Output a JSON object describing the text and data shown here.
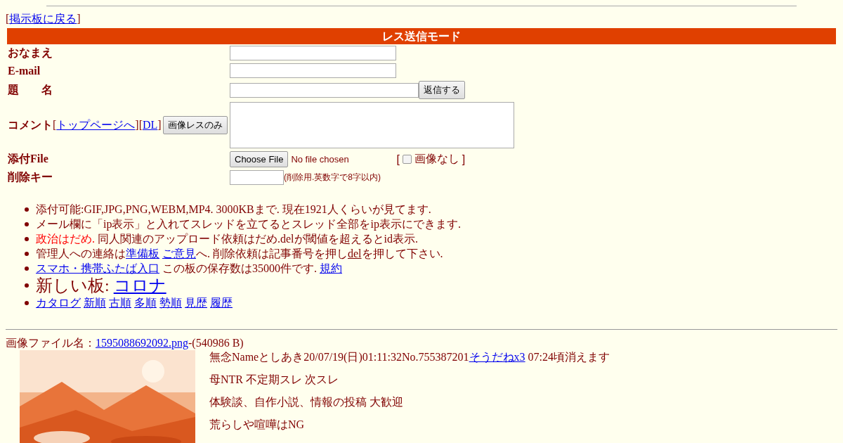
{
  "back_nav": [
    {
      "kind": "plain",
      "text": "["
    },
    {
      "kind": "link",
      "text": "掲示板に戻る"
    },
    {
      "kind": "plain",
      "text": "]"
    }
  ],
  "form": {
    "title": "レス送信モード",
    "rows": [
      {
        "kind": "text",
        "label": "おなまえ"
      },
      {
        "kind": "text",
        "label": "E-mail"
      },
      {
        "kind": "subject",
        "label": "題　　名",
        "button": "返信する"
      },
      {
        "kind": "comment",
        "label": "コメント",
        "extra": [
          {
            "kind": "plain",
            "text": "["
          },
          {
            "kind": "link",
            "text": "トップページへ"
          },
          {
            "kind": "plain",
            "text": "]["
          },
          {
            "kind": "link",
            "text": "DL"
          },
          {
            "kind": "plain",
            "text": "]"
          }
        ],
        "button": "画像レスのみ"
      },
      {
        "kind": "file",
        "label": "添付File",
        "button": "Choose File",
        "status": "No file chosen",
        "bracket_open": "[",
        "option": "画像なし",
        "bracket_close": "]",
        "checked": false
      },
      {
        "kind": "key",
        "label": "削除キー",
        "note": "(削除用.英数字で8字以内)"
      }
    ]
  },
  "notices": [
    {
      "large": false,
      "parts": [
        {
          "kind": "plain",
          "text": "添付可能:GIF,JPG,PNG,WEBM,MP4. 3000KBまで. 現在1921人くらいが見てます."
        }
      ]
    },
    {
      "large": false,
      "parts": [
        {
          "kind": "plain",
          "text": "メール欄に「ip表示」と入れてスレッドを立てるとスレッド全部をip表示にできます."
        }
      ]
    },
    {
      "large": false,
      "parts": [
        {
          "kind": "alert",
          "text": "政治はだめ."
        },
        {
          "kind": "plain",
          "text": " 同人関連のアップロード依頼はだめ.delが閾値を超えるとid表示."
        }
      ]
    },
    {
      "large": false,
      "parts": [
        {
          "kind": "plain",
          "text": "管理人への連絡は"
        },
        {
          "kind": "link",
          "text": "準備板"
        },
        {
          "kind": "link",
          "text": "ご意見"
        },
        {
          "kind": "plain",
          "text": "へ. 削除依頼は記事番号を押し"
        },
        {
          "kind": "underline",
          "text": "del"
        },
        {
          "kind": "plain",
          "text": "を押して下さい."
        }
      ]
    },
    {
      "large": false,
      "parts": [
        {
          "kind": "link",
          "text": "スマホ・携帯ふたば入口"
        },
        {
          "kind": "plain",
          "text": " この板の保存数は35000件です. "
        },
        {
          "kind": "link",
          "text": "規約"
        }
      ]
    },
    {
      "large": true,
      "parts": [
        {
          "kind": "plain",
          "text": "新しい板: "
        },
        {
          "kind": "link",
          "text": "コロナ"
        }
      ]
    },
    {
      "large": false,
      "parts": [
        {
          "kind": "link",
          "text": "カタログ"
        },
        {
          "kind": "link",
          "text": "新順"
        },
        {
          "kind": "link",
          "text": "古順"
        },
        {
          "kind": "link",
          "text": "多順"
        },
        {
          "kind": "link",
          "text": "勢順"
        },
        {
          "kind": "link",
          "text": "見歴"
        },
        {
          "kind": "link",
          "text": "履歴"
        }
      ]
    }
  ],
  "post": {
    "file_line": [
      {
        "kind": "plain",
        "text": "画像ファイル名："
      },
      {
        "kind": "link",
        "text": "1595088692092.png"
      },
      {
        "kind": "plain",
        "text": "-(540986 B)"
      }
    ],
    "header": [
      {
        "kind": "plain",
        "text": "無念Nameとしあき20/07/19(日)01:11:32No.755387201"
      },
      {
        "kind": "link",
        "text": "そうだねx3"
      },
      {
        "kind": "plain",
        "text": " 07:24頃消えます"
      }
    ],
    "body": [
      "母NTR 不定期スレ 次スレ",
      "体験談、自作小説、情報の投稿 大歓迎",
      "荒らしや喧嘩はNG"
    ]
  }
}
